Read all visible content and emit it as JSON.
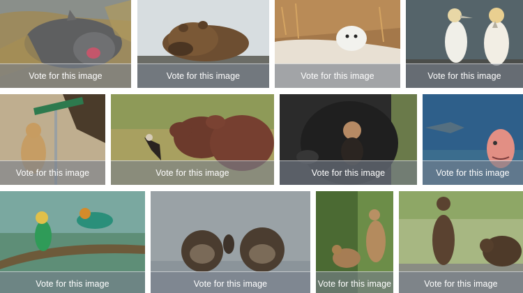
{
  "vote_label": "Vote for this image",
  "gallery": {
    "images": [
      {
        "name": "seal-photo"
      },
      {
        "name": "bear-photo"
      },
      {
        "name": "owl-photo"
      },
      {
        "name": "gannets-photo"
      },
      {
        "name": "squirrel-sign-photo"
      },
      {
        "name": "capybara-photo"
      },
      {
        "name": "chimpanzee-photo"
      },
      {
        "name": "fish-shark-photo"
      },
      {
        "name": "bee-eaters-photo"
      },
      {
        "name": "otters-photo"
      },
      {
        "name": "monkeys-photo"
      },
      {
        "name": "bear-cubs-photo"
      }
    ]
  }
}
